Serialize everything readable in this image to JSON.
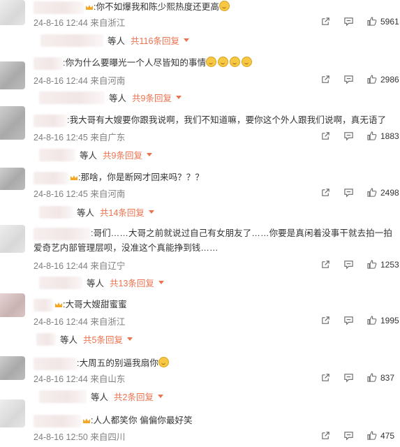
{
  "comments": [
    {
      "text": ":你不如爆我和陈少熙热度还更高",
      "emojis": 1,
      "date": "24-8-16 12:44",
      "location": "来自浙江",
      "likes": "5961",
      "reply_users": "等人",
      "reply_count": "共116条回复"
    },
    {
      "text": ":你为什么要曝光一个人尽皆知的事情",
      "emojis": 4,
      "date": "24-8-16 12:44",
      "location": "来自河南",
      "likes": "2986",
      "reply_users": "等人",
      "reply_count": "共9条回复"
    },
    {
      "text": ":我大哥有大嫂要你跟我说啊，我们不知道嘛，要你这个外人跟我们说啊，真无语了",
      "emojis": 0,
      "date": "24-8-16 12:45",
      "location": "来自广东",
      "likes": "1883",
      "reply_users": "等人",
      "reply_count": "共9条回复"
    },
    {
      "text": ":那啥，你是断网才回来吗？？？",
      "emojis": 0,
      "date": "24-8-16 12:45",
      "location": "来自河南",
      "likes": "2498",
      "reply_users": "等人",
      "reply_count": "共14条回复"
    },
    {
      "text": ":哥们……大哥之前就说过自己有女朋友了……你要是真闲着没事干就去拍一拍爱奇艺内部管理层呗，没准这个真能挣到钱……",
      "emojis": 0,
      "date": "24-8-16 12:44",
      "location": "来自辽宁",
      "likes": "1253",
      "reply_users": "等人",
      "reply_count": "共13条回复"
    },
    {
      "text": ":大哥大嫂甜蜜蜜",
      "emojis": 0,
      "date": "24-8-16 12:44",
      "location": "来自浙江",
      "likes": "1995",
      "reply_users": "等人",
      "reply_count": "共5条回复"
    },
    {
      "text": ":大周五的别逼我扇你",
      "emojis": 1,
      "date": "24-8-16 12:44",
      "location": "来自山东",
      "likes": "837",
      "reply_users": "等人",
      "reply_count": "共2条回复"
    },
    {
      "text": ":人人都笑你 偏偏你最好笑",
      "emojis": 0,
      "date": "24-8-16 12:50",
      "location": "来自四川",
      "likes": "475",
      "reply_users": "",
      "reply_count": ""
    }
  ],
  "icons": {
    "share": "share-icon",
    "comment": "comment-icon",
    "like": "thumbs-up-icon",
    "crown": "crown-badge-icon",
    "caret": "caret-down-icon"
  },
  "colors": {
    "accent": "#eb7350",
    "meta_text": "#808080",
    "body_text": "#333333"
  }
}
